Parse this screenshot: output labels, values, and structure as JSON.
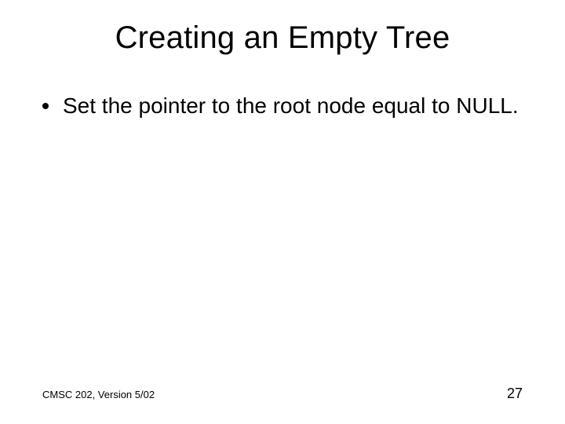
{
  "slide": {
    "title": "Creating an Empty Tree",
    "bullets": [
      "Set the pointer to the root node equal to NULL."
    ],
    "footer_left": "CMSC 202, Version 5/02",
    "page_number": "27"
  }
}
